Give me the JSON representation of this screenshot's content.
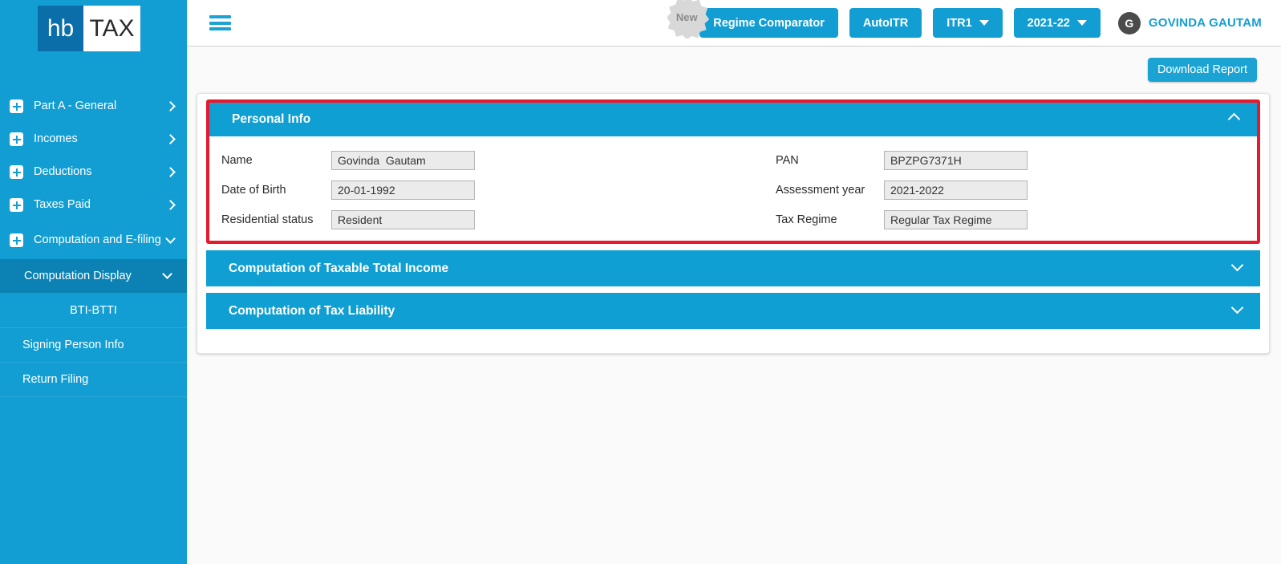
{
  "brand": {
    "logo_left": "hb",
    "logo_right": "TAX"
  },
  "sidebar": {
    "items": [
      {
        "label": "Part A - General",
        "icon": "plus-square-icon",
        "chevron": "chevron-right-icon"
      },
      {
        "label": "Incomes",
        "icon": "plus-square-icon",
        "chevron": "chevron-right-icon"
      },
      {
        "label": "Deductions",
        "icon": "plus-square-icon",
        "chevron": "chevron-right-icon"
      },
      {
        "label": "Taxes Paid",
        "icon": "plus-square-icon",
        "chevron": "chevron-right-icon"
      },
      {
        "label": "Computation and E-filing",
        "icon": "plus-square-icon",
        "chevron": "chevron-down-icon"
      }
    ],
    "sub_items": [
      {
        "label": "Computation Display",
        "active": true,
        "chevron": "chevron-down-icon"
      },
      {
        "label": "BTI-BTTI",
        "active": false
      },
      {
        "label": "Signing Person Info",
        "active": false
      },
      {
        "label": "Return Filing",
        "active": false
      }
    ],
    "bg_color": "#139ed3",
    "active_color": "#0b82b3"
  },
  "topbar": {
    "menu_icon": "hamburger-icon",
    "new_badge": "New",
    "buttons": [
      {
        "label": "Regime Comparator",
        "has_caret": false
      },
      {
        "label": "AutoITR",
        "has_caret": false
      },
      {
        "label": "ITR1",
        "has_caret": true
      },
      {
        "label": "2021-22",
        "has_caret": true
      }
    ],
    "user": {
      "initial": "G",
      "name": "GOVINDA GAUTAM"
    },
    "accent_color": "#139ed3"
  },
  "content": {
    "download_button": "Download Report",
    "panels": [
      {
        "title": "Personal Info",
        "expanded": true,
        "highlighted": true,
        "chevron": "chevron-up-icon",
        "fields_left": [
          {
            "label": "Name",
            "value": "Govinda  Gautam"
          },
          {
            "label": "Date of Birth",
            "value": "20-01-1992"
          },
          {
            "label": "Residential status",
            "value": "Resident"
          }
        ],
        "fields_right": [
          {
            "label": "PAN",
            "value": "BPZPG7371H"
          },
          {
            "label": "Assessment year",
            "value": "2021-2022"
          },
          {
            "label": "Tax Regime",
            "value": "Regular Tax Regime"
          }
        ]
      },
      {
        "title": "Computation of Taxable Total Income",
        "expanded": false,
        "highlighted": false,
        "chevron": "chevron-down-icon"
      },
      {
        "title": "Computation of Tax Liability",
        "expanded": false,
        "highlighted": false,
        "chevron": "chevron-down-icon"
      }
    ],
    "highlight_color": "#e8192c",
    "panel_header_color": "#0f9fd3"
  }
}
